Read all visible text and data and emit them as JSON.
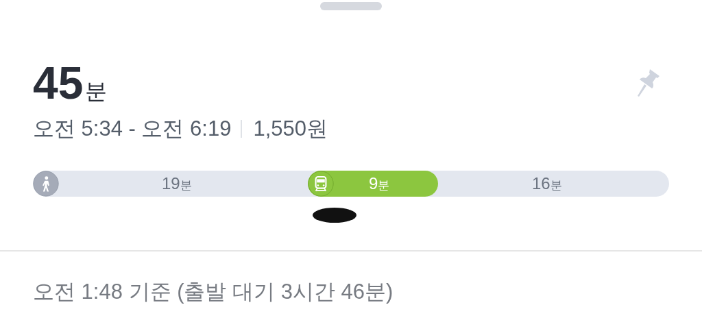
{
  "summary": {
    "duration_value": "45",
    "duration_unit": "분",
    "time_range": "오전 5:34 - 오전 6:19",
    "fare": "1,550원"
  },
  "segments": [
    {
      "kind": "walk",
      "number": "19",
      "unit": "분"
    },
    {
      "kind": "subway",
      "number": "9",
      "unit": "분",
      "color": "#8cc63f"
    },
    {
      "kind": "plain",
      "number": "16",
      "unit": "분"
    }
  ],
  "footer": {
    "text": "오전 1:48 기준 (출발 대기 3시간 46분)"
  }
}
